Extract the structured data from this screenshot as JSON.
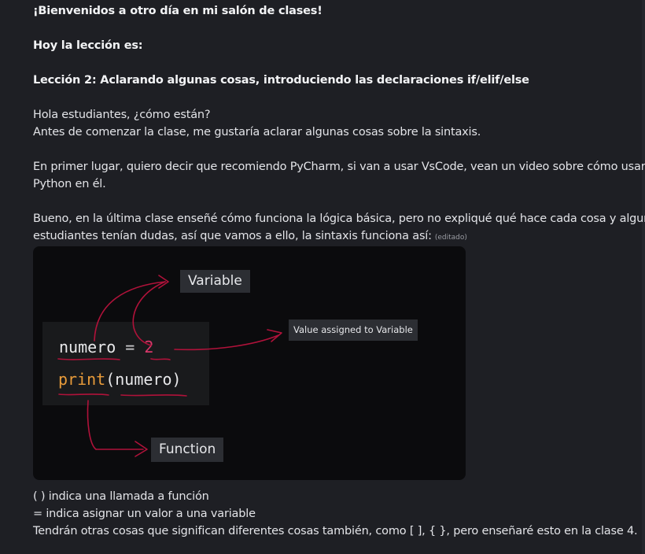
{
  "message": {
    "heading": "¡Bienvenidos a otro día en mi salón de clases!",
    "subheading": "Hoy la lección es:",
    "lesson_title": "Lección 2: Aclarando algunas cosas, introduciendo las declaraciones if/elif/else",
    "paragraph1_line1": "Hola estudiantes, ¿cómo están?",
    "paragraph1_line2": "Antes de comenzar la clase, me gustaría aclarar algunas cosas sobre la sintaxis.",
    "paragraph2_line1": "En primer lugar, quiero decir que recomiendo PyCharm, si van a usar VsCode, vean un video sobre cómo usar",
    "paragraph2_line2": "Python en él.",
    "paragraph3_line1": "Bueno, en la última clase enseñé cómo funciona la lógica básica, pero no expliqué qué hace cada cosa y algunos",
    "paragraph3_line2": "estudiantes tenían dudas, así que vamos a ello, la sintaxis funciona así:",
    "edited_tag": "(editado)",
    "footer_line1": "( ) indica una llamada a función",
    "footer_line2": "= indica asignar un valor a una variable",
    "footer_line3": "Tendrán otras cosas que significan diferentes cosas también, como [ ], { }, pero enseñaré esto en la clase 4."
  },
  "image": {
    "code_line1_var": "numero",
    "code_line1_op": "=",
    "code_line1_num": "2",
    "code_line2_fn": "print",
    "code_line2_args": "(numero)",
    "label_variable": "Variable",
    "label_value": "Value assigned to Variable",
    "label_function": "Function",
    "annotation_color": "#b0123a"
  }
}
